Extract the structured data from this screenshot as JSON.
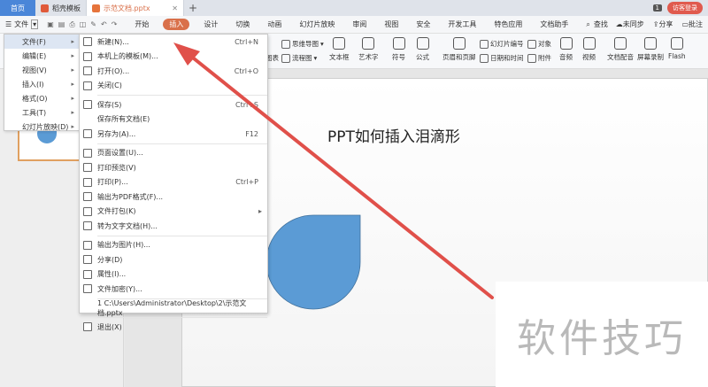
{
  "titlebar": {
    "home_tab": "首页",
    "template_tab": "稻壳模板",
    "doc_tab": "示范文档.pptx",
    "page_count": "1",
    "login": "访客登录"
  },
  "menubar": {
    "file_label": "文件",
    "tabs": [
      "开始",
      "插入",
      "设计",
      "切换",
      "动画",
      "幻灯片放映",
      "审阅",
      "视图",
      "安全",
      "开发工具",
      "特色应用",
      "文档助手"
    ],
    "active_tab": "插入",
    "search_label": "查找",
    "sync_label": "未同步",
    "share_label": "分享",
    "comment_label": "批注"
  },
  "ribbon": {
    "items": {
      "mindmap": "思维导图",
      "flowchart": "流程图",
      "chart": "图表",
      "textbox": "文本框",
      "wordart": "艺术字",
      "symbol": "符号",
      "formula": "公式",
      "header_footer": "页眉和页脚",
      "slide_number": "幻灯片编号",
      "datetime": "日期和时间",
      "object": "对象",
      "attachment": "附件",
      "audio": "音频",
      "video": "视频",
      "dub": "文档配音",
      "screen_rec": "屏幕录制",
      "flash": "Flash"
    }
  },
  "menu_level1": {
    "items": [
      {
        "label": "文件(F)",
        "arrow": "▸"
      },
      {
        "label": "编辑(E)",
        "arrow": "▸"
      },
      {
        "label": "视图(V)",
        "arrow": "▸"
      },
      {
        "label": "插入(I)",
        "arrow": "▸"
      },
      {
        "label": "格式(O)",
        "arrow": "▸"
      },
      {
        "label": "工具(T)",
        "arrow": "▸"
      },
      {
        "label": "幻灯片放映(D)",
        "arrow": "▸"
      }
    ]
  },
  "menu_file": {
    "items": [
      {
        "label": "新建(N)...",
        "shortcut": "Ctrl+N"
      },
      {
        "label": "本机上的模板(M)...",
        "shortcut": ""
      },
      {
        "label": "打开(O)...",
        "shortcut": "Ctrl+O"
      },
      {
        "label": "关闭(C)",
        "shortcut": ""
      },
      {
        "label": "保存(S)",
        "shortcut": "Ctrl+S"
      },
      {
        "label": "保存所有文档(E)",
        "shortcut": ""
      },
      {
        "label": "另存为(A)...",
        "shortcut": "F12"
      },
      {
        "label": "页面设置(U)...",
        "shortcut": ""
      },
      {
        "label": "打印预览(V)",
        "shortcut": ""
      },
      {
        "label": "打印(P)...",
        "shortcut": "Ctrl+P"
      },
      {
        "label": "输出为PDF格式(F)...",
        "shortcut": ""
      },
      {
        "label": "文件打包(K)",
        "shortcut": "▸"
      },
      {
        "label": "转为文字文档(H)...",
        "shortcut": ""
      },
      {
        "label": "输出为图片(H)...",
        "shortcut": ""
      },
      {
        "label": "分享(D)",
        "shortcut": ""
      },
      {
        "label": "属性(I)...",
        "shortcut": ""
      },
      {
        "label": "文件加密(Y)...",
        "shortcut": ""
      },
      {
        "label": "1 C:\\Users\\Administrator\\Desktop\\2\\示范文档.pptx",
        "shortcut": ""
      },
      {
        "label": "退出(X)",
        "shortcut": ""
      }
    ]
  },
  "slide": {
    "title": "PPT如何插入泪滴形",
    "shape_color": "#5b9bd5"
  },
  "watermark": "软件技巧",
  "colors": {
    "accent": "#d9704a",
    "arrow": "#e0504a",
    "home_tab": "#4a86d8"
  }
}
